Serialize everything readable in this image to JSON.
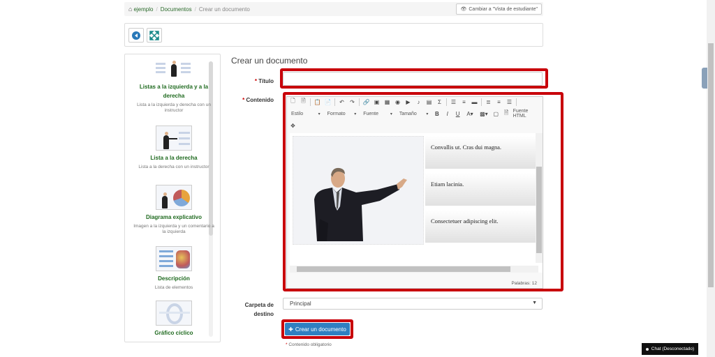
{
  "breadcrumb": {
    "items": [
      "ejemplo",
      "Documentos"
    ],
    "current": "Crear un documento",
    "student_view": "Cambiar a \"Vista de estudiante\""
  },
  "templates": [
    {
      "name": "Listas a la izquierda y a la derecha",
      "desc": "Lista a la izquierda y derecha con un instructor"
    },
    {
      "name": "Lista a la derecha",
      "desc": "Lista a la derecha con un instructor"
    },
    {
      "name": "Diagrama explicativo",
      "desc": "Imagen a la izquierda y un comentario a la izquierda"
    },
    {
      "name": "Descripción",
      "desc": "Lista de elementos"
    },
    {
      "name": "Gráfico cíclico",
      "desc": ""
    }
  ],
  "form": {
    "heading": "Crear un documento",
    "title_label": "Título",
    "title_value": "",
    "content_label": "Contenido",
    "folder_label_line1": "Carpeta de",
    "folder_label_line2": "destino",
    "folder_value": "Principal",
    "submit_label": "Crear un documento",
    "required_note": "Contenido obligatorio",
    "required_mark": "*"
  },
  "editor": {
    "combos": [
      "Estilo",
      "Formato",
      "Fuente",
      "Tamaño"
    ],
    "html_source_label": "Fuente HTML",
    "cells": [
      "Convallis ut. Cras dui magna.",
      "Etiam lacinia.",
      "Consectetuer adipiscing elit."
    ],
    "word_count": "Palabras: 12"
  },
  "chat_label": "Chat (Desconectado)",
  "colors": {
    "highlight": "#c8000a",
    "primary": "#2f7fc1",
    "link": "#1f6a1f"
  }
}
